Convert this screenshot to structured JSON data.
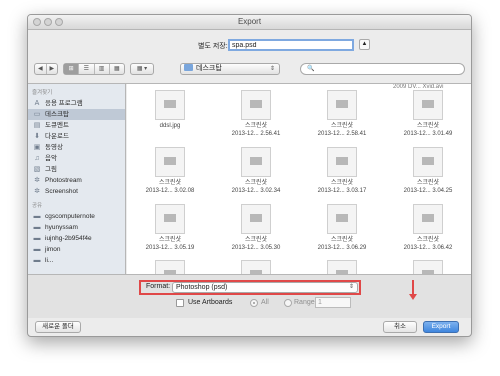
{
  "window": {
    "title": "Export"
  },
  "save": {
    "label": "별도 저장:",
    "value": "spa.psd",
    "expand": "▲"
  },
  "toolbar": {
    "nav": [
      "◀",
      "▶"
    ],
    "views": [
      "⊞",
      "☰",
      "▥",
      "▦"
    ],
    "arrange": [
      "▦ ▾"
    ],
    "location": "데스크탑",
    "location_arrow": "⇕",
    "search_icon": "🔍"
  },
  "sidebar": {
    "favorites_heading": "즐겨찾기",
    "favorites": [
      {
        "icon": "A",
        "label": "응용 프로그램"
      },
      {
        "icon": "▭",
        "label": "데스크탑",
        "selected": true
      },
      {
        "icon": "▤",
        "label": "도큐멘트"
      },
      {
        "icon": "⬇",
        "label": "다운로드"
      },
      {
        "icon": "▣",
        "label": "동영상"
      },
      {
        "icon": "♫",
        "label": "음악"
      },
      {
        "icon": "▧",
        "label": "그림"
      },
      {
        "icon": "✲",
        "label": "Photostream"
      },
      {
        "icon": "✲",
        "label": "Screenshot"
      }
    ],
    "shared_heading": "공유",
    "shared": [
      {
        "icon": "▬",
        "label": "cgscomputernote"
      },
      {
        "icon": "▬",
        "label": "hyunyssam"
      },
      {
        "icon": "▬",
        "label": "iujnhg-2b954f4e"
      },
      {
        "icon": "▬",
        "label": "jimon"
      },
      {
        "icon": "▬",
        "label": "li..."
      }
    ]
  },
  "files": {
    "partial_label": "2009 DV... Xvid.avi",
    "items": [
      {
        "name": "",
        "sub": ""
      },
      {
        "name": "스크린샷",
        "sub": "2013-12... 2.56.41"
      },
      {
        "name": "스크린샷",
        "sub": "2013-12... 2.58.41"
      },
      {
        "name": "스크린샷",
        "sub": "2013-12... 3.01.49"
      },
      {
        "name": "스크린샷",
        "sub": "2013-12... 3.02.08"
      },
      {
        "name": "스크린샷",
        "sub": "2013-12... 3.02.34"
      },
      {
        "name": "스크린샷",
        "sub": "2013-12... 3.03.17"
      },
      {
        "name": "스크린샷",
        "sub": "2013-12... 3.04.25"
      },
      {
        "name": "스크린샷",
        "sub": "2013-12... 3.05.19"
      },
      {
        "name": "스크린샷",
        "sub": "2013-12... 3.05.30"
      },
      {
        "name": "스크린샷",
        "sub": "2013-12... 3.06.29"
      },
      {
        "name": "스크린샷",
        "sub": "2013-12... 3.06.42"
      }
    ],
    "first_file_name": "ddsl.jpg"
  },
  "options": {
    "format_label": "Format:",
    "format_value": "Photoshop (psd)",
    "format_arrow": "⇕",
    "use_artboards": "Use Artboards",
    "all_label": "All",
    "range_label": "Range:",
    "range_value": "1"
  },
  "buttons": {
    "new_folder": "새로운 폴더",
    "cancel": "취소",
    "export": "Export"
  },
  "colors": {
    "highlight": "#e04848",
    "primary": "#3f86de"
  }
}
